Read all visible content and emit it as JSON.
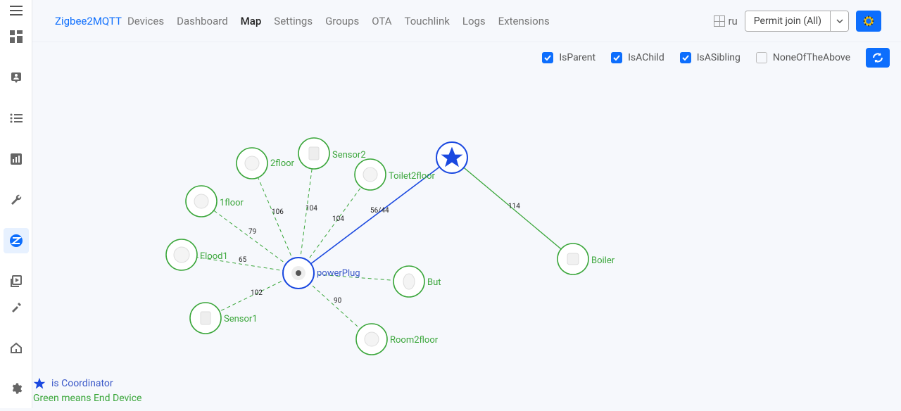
{
  "brand": "Zigbee2MQTT",
  "nav": {
    "devices": "Devices",
    "dashboard": "Dashboard",
    "map": "Map",
    "settings": "Settings",
    "groups": "Groups",
    "ota": "OTA",
    "touchlink": "Touchlink",
    "logs": "Logs",
    "extensions": "Extensions"
  },
  "lang_label": "ru",
  "permit_label": "Permit join (All)",
  "filters": {
    "is_parent": "IsParent",
    "is_a_child": "IsAChild",
    "is_a_sibling": "IsASibling",
    "none_of_the_above": "NoneOfTheAbove"
  },
  "legend": {
    "coordinator": "is Coordinator",
    "enddevice": "Green means End Device"
  },
  "nodes": {
    "coordinator": "",
    "powerplug": "powerPlug",
    "boiler": "Boiler",
    "floor2": "2floor",
    "floor1": "1floor",
    "flood1": "Flood1",
    "sensor1": "Sensor1",
    "sensor2": "Sensor2",
    "toilet2floor": "Toilet2floor",
    "but": "But",
    "room2floor": "Room2floor"
  },
  "lqi": {
    "floor2": "106",
    "sensor2": "104",
    "toilet": "104",
    "coord": "56/44",
    "boiler": "114",
    "floor1": "79",
    "flood1": "65",
    "sensor1": "102",
    "room2": "90"
  }
}
